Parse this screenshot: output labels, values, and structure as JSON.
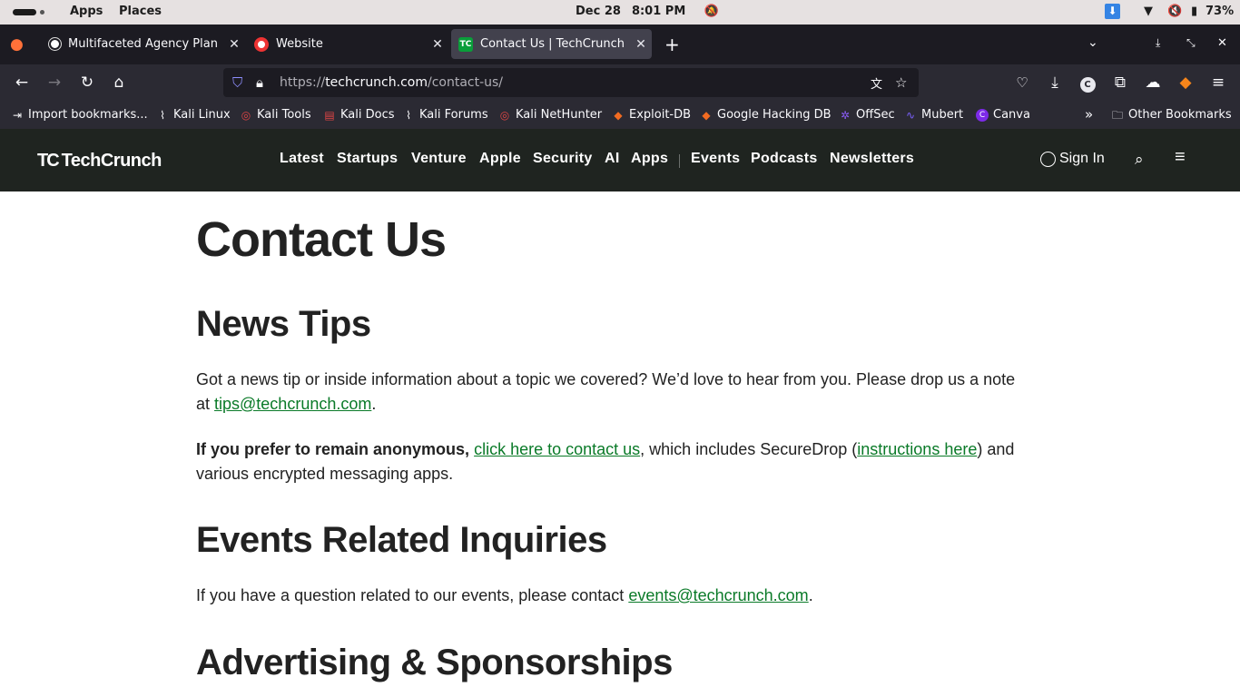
{
  "topbar": {
    "apps": "Apps",
    "places": "Places",
    "date": "Dec 28",
    "time": "8:01 PM",
    "battery": "73%"
  },
  "tabs": [
    {
      "title": "Multifaceted Agency Plan",
      "close": "✕"
    },
    {
      "title": "Website",
      "close": "✕"
    },
    {
      "title": "Contact Us | TechCrunch",
      "close": "✕"
    }
  ],
  "new_tab": "+",
  "url": {
    "prefix": "https://",
    "domain": "techcrunch.com",
    "path": "/contact-us/"
  },
  "bookmarks": [
    "Import bookmarks...",
    "Kali Linux",
    "Kali Tools",
    "Kali Docs",
    "Kali Forums",
    "Kali NetHunter",
    "Exploit-DB",
    "Google Hacking DB",
    "OffSec",
    "Mubert",
    "Canva"
  ],
  "other_bookmarks": "Other Bookmarks",
  "tc": {
    "logo_mark": "TC",
    "logo_text": "TechCrunch",
    "nav": [
      "Latest",
      "Startups",
      "Venture",
      "Apple",
      "Security",
      "AI",
      "Apps",
      "Events",
      "Podcasts",
      "Newsletters"
    ],
    "sign_in": "Sign In"
  },
  "page": {
    "title": "Contact Us",
    "news_tips_heading": "News Tips",
    "news_tips_text": "Got a news tip or inside information about a topic we covered? We’d love to hear from you. Please drop us a note at ",
    "tips_email": "tips@techcrunch.com",
    "period": ".",
    "anon_bold": "If you prefer to remain anonymous,",
    "anon_link": "click here to contact us",
    "anon_mid": ", which includes SecureDrop (",
    "instructions_link": "instructions here",
    "anon_end": ") and various encrypted messaging apps.",
    "events_heading": "Events Related Inquiries",
    "events_text": "If you have a question related to our events, please contact ",
    "events_email": "events@techcrunch.com",
    "advertising_heading": "Advertising & Sponsorships"
  }
}
